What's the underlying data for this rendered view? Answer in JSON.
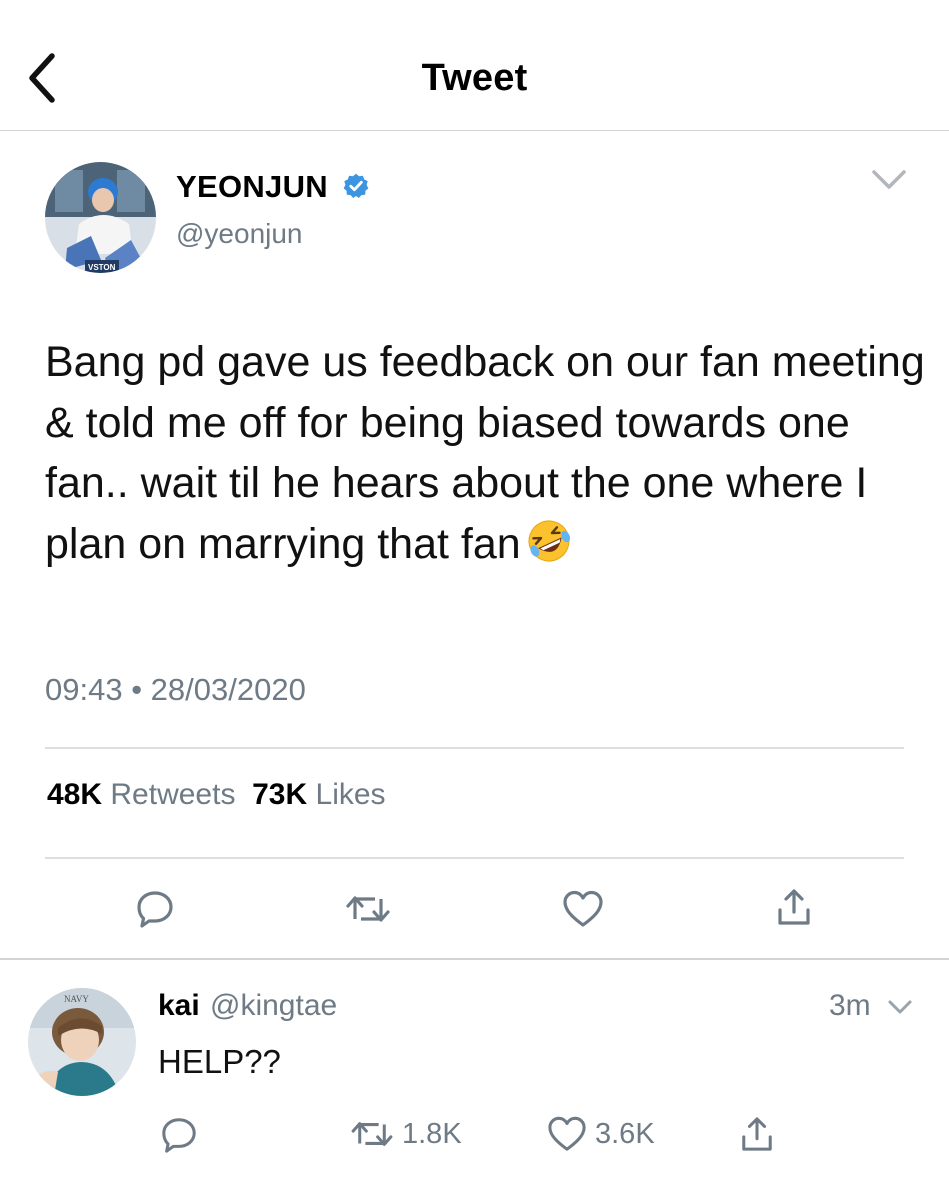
{
  "header": {
    "title": "Tweet",
    "back_icon": "chevron-left-icon"
  },
  "tweet": {
    "author_name": "YEONJUN",
    "handle": "@yeonjun",
    "verified": true,
    "text": "Bang pd gave us feedback on our fan meeting & told me off for being biased towards one fan.. wait til he hears about the one where I plan on marrying that fan",
    "emoji": "rolling-on-the-floor-laughing-emoji",
    "timestamp": "09:43 • 28/03/2020",
    "retweets_count": "48K",
    "retweets_label": "Retweets",
    "likes_count": "73K",
    "likes_label": "Likes",
    "avatar_caption": "VSTON"
  },
  "reply": {
    "author_name": "kai",
    "handle": "@kingtae",
    "time": "3m",
    "text": "HELP??",
    "retweet_count": "1.8K",
    "like_count": "3.6K",
    "avatar_caption": "NAVY"
  },
  "colors": {
    "accent_blue": "#1d9bf0",
    "secondary_text": "#6e7a85",
    "icon_gray": "#6e7a85",
    "divider": "#dedede"
  }
}
